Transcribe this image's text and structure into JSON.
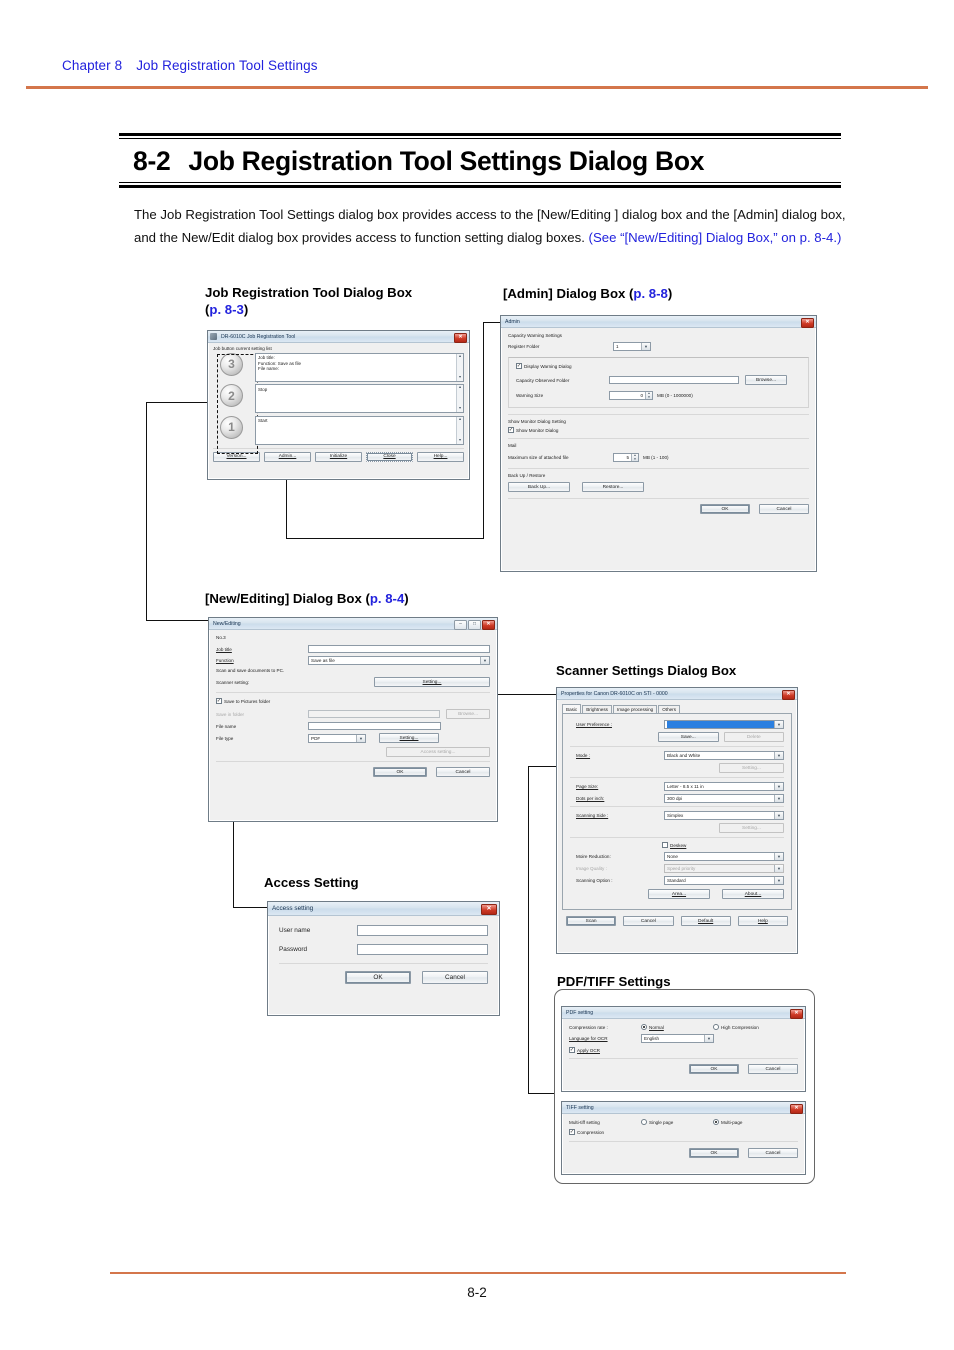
{
  "header": {
    "chapter": "Chapter 8",
    "section": "Job Registration Tool Settings"
  },
  "footer": {
    "page_number": "8-2"
  },
  "heading": {
    "number": "8-2",
    "title": "Job Registration Tool Settings Dialog Box"
  },
  "intro": {
    "line1": "The Job Registration Tool Settings dialog box provides access to the [New/Editing ] dialog box and",
    "line2": "the [Admin] dialog box, and the New/Edit dialog box provides access to function setting dialog",
    "line3_prefix": "boxes. ",
    "line3_link": "(See “[New/Editing] Dialog Box,” on p. 8-4.)"
  },
  "captions": {
    "job_tool": {
      "text": "Job Registration Tool Dialog Box",
      "page_open": "(",
      "page": "p. 8-3",
      "page_close": ")"
    },
    "admin": {
      "prefix": "[Admin] Dialog Box (",
      "page": "p. 8-8",
      "suffix": ")"
    },
    "new_editing": {
      "prefix": "[New/Editing] Dialog Box (",
      "page": "p. 8-4",
      "suffix": ")"
    },
    "scanner": {
      "text": "Scanner Settings Dialog Box"
    },
    "access": {
      "text": "Access Setting"
    },
    "pdftiff": {
      "text": "PDF/TIFF Settings"
    }
  },
  "job_tool_dialog": {
    "title": "DR-6010C Job Registration Tool",
    "close_glyph": "✕",
    "list_label": "Job button current setting list",
    "items": [
      {
        "number": "3",
        "lines": [
          "Job title:",
          "Function: Save as file",
          "File name:"
        ]
      },
      {
        "number": "2",
        "lines": [
          "Stop"
        ]
      },
      {
        "number": "1",
        "lines": [
          "Start"
        ]
      }
    ],
    "buttons": [
      {
        "label": "Version...",
        "accel": "V"
      },
      {
        "label": "Admin...",
        "accel": "A"
      },
      {
        "label": "Initialize",
        "accel": "I"
      },
      {
        "label": "Close",
        "accel": "C"
      },
      {
        "label": "Help...",
        "accel": "H"
      }
    ]
  },
  "admin_dialog": {
    "title": "Admin",
    "close_glyph": "✕",
    "capacity_heading": "Capacity Warning Settings",
    "register_folder_label": "Register Folder",
    "register_folder_value": "1",
    "display_warning_label": "Display Warning Dialog",
    "display_warning_checked": true,
    "capacity_folder_label": "Capacity Observed Folder",
    "capacity_folder_value": "",
    "browse_label": "Browse...",
    "warning_size_label": "Warning Size",
    "warning_size_value": "0",
    "warning_size_units": "MB (0 - 1000000)",
    "monitor_heading": "Show Monitor Dialog Setting",
    "show_monitor_label": "Show Monitor Dialog",
    "show_monitor_checked": true,
    "mail_heading": "Mail",
    "max_attach_label": "Maximum size of attached file",
    "max_attach_value": "5",
    "max_attach_units": "MB (1 - 100)",
    "backup_heading": "Back Up / Restore",
    "backup_label": "Back Up...",
    "restore_label": "Restore...",
    "ok_label": "OK",
    "cancel_label": "Cancel"
  },
  "new_editing_dialog": {
    "title": "New/Editing",
    "minimize_glyph": "–",
    "maximize_glyph": "□",
    "close_glyph": "✕",
    "number_label": "No.3",
    "job_title_label": "Job title",
    "job_title_value": "",
    "function_label": "Function",
    "function_value": "Save as file",
    "description": "Scan and save documents to PC.",
    "scanner_setting_label": "Scanner setting:",
    "scanner_setting_button": "Setting...",
    "save_pictures_label": "Save to Pictures folder",
    "save_pictures_checked": true,
    "save_in_folder_label": "Save in folder",
    "save_in_folder_value": "",
    "browse_label": "Browse...",
    "file_name_label": "File name",
    "file_name_value": "",
    "file_type_label": "File type",
    "file_type_value": "PDF",
    "file_type_setting_button": "Setting...",
    "access_setting_button": "Access setting...",
    "ok_label": "OK",
    "cancel_label": "Cancel"
  },
  "scanner_dialog": {
    "title": "Properties for Canon DR-6010C on STI - 0000",
    "close_glyph": "✕",
    "tabs": [
      "Basic",
      "Brightness",
      "Image processing",
      "Others"
    ],
    "selected_tab": "Basic",
    "user_preference_label": "User Preference :",
    "user_preference_value": "",
    "save_label": "Save...",
    "delete_label": "Delete",
    "mode_label": "Mode :",
    "mode_value": "Black and White",
    "mode_setting_label": "Setting...",
    "page_size_label": "Page Size:",
    "page_size_value": "Letter - 8.5 x 11 in",
    "dpi_label": "Dots per inch:",
    "dpi_value": "300 dpi",
    "scanning_side_label": "Scanning Side :",
    "scanning_side_value": "Simplex",
    "side_setting_label": "Setting...",
    "deskew_label": "Deskew",
    "deskew_checked": false,
    "moire_label": "Moire Reduction:",
    "moire_value": "None",
    "image_quality_label": "Image Quality :",
    "image_quality_value": "Speed priority",
    "scanning_option_label": "Scanning Option :",
    "scanning_option_value": "Standard",
    "area_label": "Area...",
    "about_label": "About...",
    "scan_label": "Scan",
    "cancel_label": "Cancel",
    "default_label": "Default",
    "help_label": "Help"
  },
  "access_dialog": {
    "title": "Access setting",
    "close_glyph": "✕",
    "user_name_label": "User name",
    "user_name_value": "",
    "password_label": "Password",
    "password_value": "",
    "ok_label": "OK",
    "cancel_label": "Cancel"
  },
  "pdf_dialog": {
    "title": "PDF setting",
    "close_glyph": "✕",
    "compression_label": "Compression rate :",
    "option_normal": "Normal",
    "option_high": "High Compression",
    "selected_compression": "Normal",
    "language_label": "Language for OCR",
    "language_value": "English",
    "apply_ocr_label": "Apply OCR",
    "apply_ocr_checked": true,
    "ok_label": "OK",
    "cancel_label": "Cancel"
  },
  "tiff_dialog": {
    "title": "TIFF setting",
    "close_glyph": "✕",
    "multitiff_label": "Multi-tiff setting",
    "option_single": "Single page",
    "option_multi": "Multi-page",
    "selected_multitiff": "Multi-page",
    "compression_label": "Compression",
    "compression_checked": true,
    "ok_label": "OK",
    "cancel_label": "Cancel"
  },
  "colors": {
    "rule": "#d4764b",
    "link": "#2222dd",
    "titlebar": "#cbdceb"
  }
}
